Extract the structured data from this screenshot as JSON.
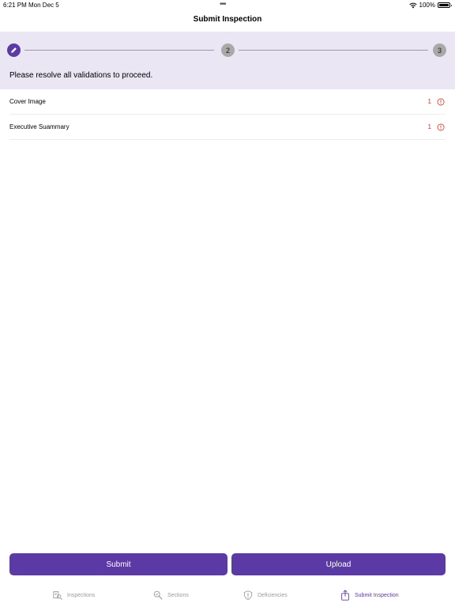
{
  "status_bar": {
    "time": "6:21 PM",
    "date": "Mon Dec 5",
    "more": "•••",
    "battery": "100%"
  },
  "nav": {
    "title": "Submit Inspection"
  },
  "stepper": {
    "steps": [
      {
        "label": "",
        "icon": "pencil-icon",
        "state": "current"
      },
      {
        "label": "2",
        "state": "pending"
      },
      {
        "label": "3",
        "state": "pending"
      }
    ],
    "message": "Please resolve all validations to proceed."
  },
  "validations": [
    {
      "label": "Cover Image",
      "count": "1",
      "icon": "alert-circle-icon"
    },
    {
      "label": "Executive Suammary",
      "count": "1",
      "icon": "alert-circle-icon"
    }
  ],
  "actions": {
    "submit_label": "Submit",
    "upload_label": "Upload"
  },
  "tabs": [
    {
      "label": "Inspections",
      "icon": "inspections-icon",
      "active": false
    },
    {
      "label": "Sections",
      "icon": "sections-icon",
      "active": false
    },
    {
      "label": "Deficiencies",
      "icon": "deficiencies-icon",
      "active": false
    },
    {
      "label": "Submit Inspection",
      "icon": "upload-icon",
      "active": true
    }
  ],
  "colors": {
    "accent": "#5b3aa5",
    "stepper_bg": "#ebe6f4",
    "error": "#e0301e",
    "inactive": "#9a9a9a"
  }
}
